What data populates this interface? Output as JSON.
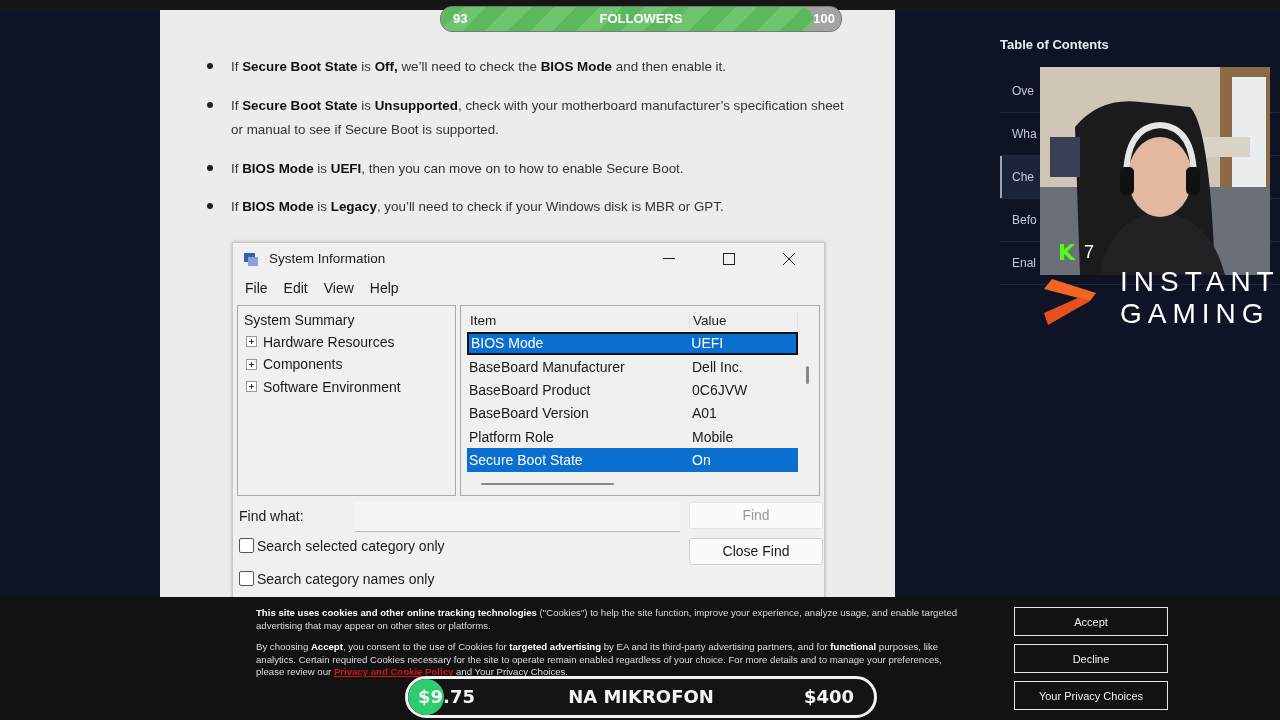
{
  "followers_bar": {
    "current": "93",
    "label": "FOLLOWERS",
    "goal": "100",
    "level": 0.93
  },
  "article": {
    "bullets": [
      "If **Secure Boot State** is **Off,** we’ll need to check the **BIOS Mode** and then enable it.",
      "If **Secure Boot State** is **Unsupported**, check with your motherboard manufacturer’s specification sheet or manual to see if Secure Boot is supported.",
      "If **BIOS Mode** is **UEFI**, then you can move on to how to enable Secure Boot.",
      "If **BIOS Mode** is **Legacy**, you’ll need to check if your Windows disk is MBR or GPT."
    ]
  },
  "system_window": {
    "title": "System Information",
    "menu": [
      "File",
      "Edit",
      "View",
      "Help"
    ],
    "tree": {
      "root": "System Summary",
      "children": [
        {
          "label": "Hardware Resources",
          "expanded": false
        },
        {
          "label": "Components",
          "expanded": false
        },
        {
          "label": "Software Environment",
          "expanded": false
        }
      ]
    },
    "columns": [
      "Item",
      "Value"
    ],
    "rows": [
      {
        "item": "BIOS Mode",
        "value": "UEFI",
        "selected": true
      },
      {
        "item": "BaseBoard Manufacturer",
        "value": "Dell Inc.",
        "selected": false
      },
      {
        "item": "BaseBoard Product",
        "value": "0C6JVW",
        "selected": false
      },
      {
        "item": "BaseBoard Version",
        "value": "A01",
        "selected": false
      },
      {
        "item": "Platform Role",
        "value": "Mobile",
        "selected": false
      },
      {
        "item": "Secure Boot State",
        "value": "On",
        "selected": true
      }
    ],
    "find_label": "Find what:",
    "find_button": {
      "label": "Find",
      "disabled": true
    },
    "close_find_button": "Close Find",
    "checkboxes": [
      {
        "label": "Search selected category only",
        "checked": false
      },
      {
        "label": "Search category names only",
        "checked": false
      }
    ]
  },
  "toc": {
    "title": "Table of Contents",
    "items": [
      {
        "label": "Ove",
        "selected": false
      },
      {
        "label": "Wha",
        "selected": false
      },
      {
        "label": "Che",
        "selected": true
      },
      {
        "label": "Befo",
        "selected": false
      },
      {
        "label": "Enal",
        "selected": false
      }
    ]
  },
  "webcam": {
    "kind": "picture",
    "badge_logo": "K",
    "badge_count": "7"
  },
  "sponsor": {
    "line1": "INSTANT",
    "line2": "GAMING"
  },
  "cookie_banner": {
    "intro": "**This site uses cookies and other online tracking technologies** (\"Cookies\") to help the site function, improve your experience, analyze usage, and enable targeted advertising that may appear on other sites or platforms.",
    "consent": "By choosing **Accept**, you consent to the use of Cookies for **targeted advertising** by EA and its third-party advertising partners, and for **functional** purposes, like analytics. Certain required Cookies necessary for the site to operate remain enabled regardless of your choice. For more details and to manage your preferences, please review our",
    "link": "Privacy and Cookie Policy",
    "after_link": "and Your Privacy Choices.",
    "buttons": [
      "Accept",
      "Decline",
      "Your Privacy Choices"
    ]
  },
  "donation_goal": {
    "current": "$9.75",
    "label": "NA MIKROFON",
    "goal": "$400",
    "level": 0.024
  }
}
